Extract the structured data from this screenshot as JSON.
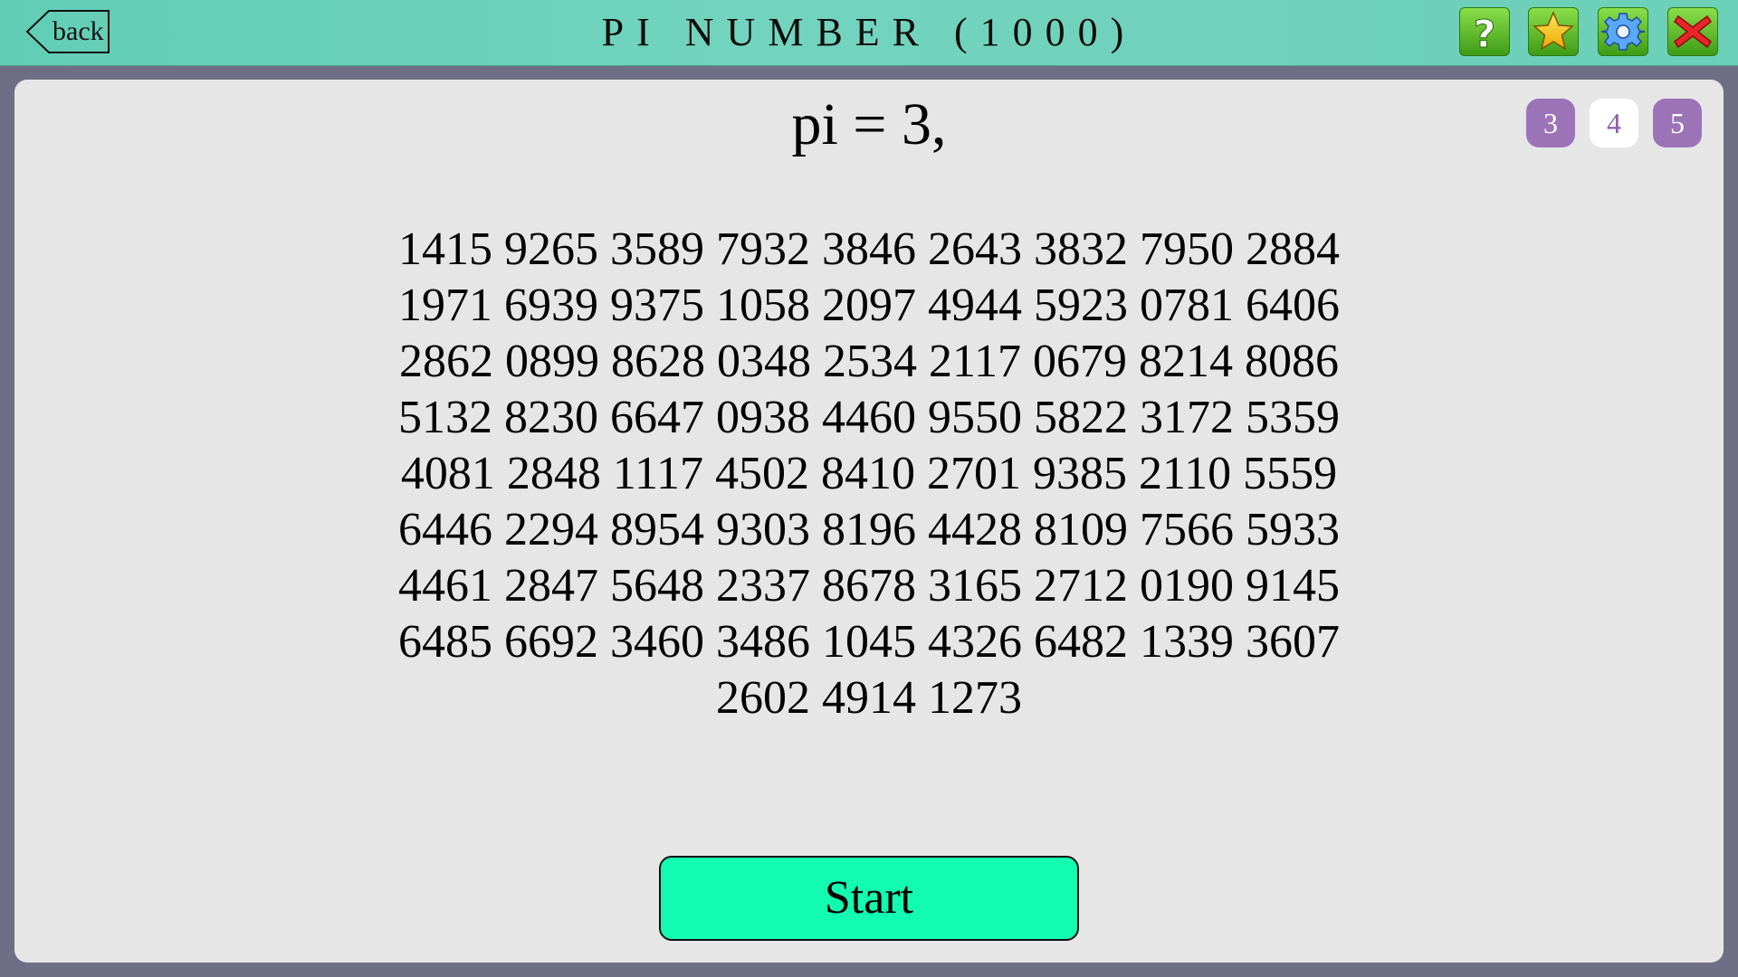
{
  "header": {
    "back_label": "back",
    "title": "PI NUMBER (1000)",
    "buttons": [
      {
        "name": "help",
        "icon": "question-icon",
        "color": "#5fbf2a"
      },
      {
        "name": "favorite",
        "icon": "star-icon",
        "color": "#5fbf2a"
      },
      {
        "name": "settings",
        "icon": "gear-icon",
        "color": "#5fbf2a"
      },
      {
        "name": "close",
        "icon": "close-icon",
        "color": "#5fbf2a"
      }
    ]
  },
  "main": {
    "pi_label": "pi = 3,",
    "group_sizes": [
      {
        "label": "3",
        "selected": false
      },
      {
        "label": "4",
        "selected": true
      },
      {
        "label": "5",
        "selected": false
      }
    ],
    "digit_lines": [
      "1415 9265 3589 7932 3846 2643 3832 7950 2884",
      "1971 6939 9375 1058 2097 4944 5923 0781 6406",
      "2862 0899 8628 0348 2534 2117 0679 8214 8086",
      "5132 8230 6647 0938 4460 9550 5822 3172 5359",
      "4081 2848 1117 4502 8410 2701 9385 2110 5559",
      "6446 2294 8954 9303 8196 4428 8109 7566 5933",
      "4461 2847 5648 2337 8678 3165 2712 0190 9145",
      "6485 6692 3460 3486 1045 4326 6482 1339 3607",
      "2602 4914 1273"
    ],
    "start_label": "Start"
  },
  "colors": {
    "header_bg": "#6ccfb8",
    "panel_bg": "#e6e6e6",
    "frame_bg": "#6e6f86",
    "group_badge": "#9d73b8",
    "start_button": "#12fbb0"
  }
}
